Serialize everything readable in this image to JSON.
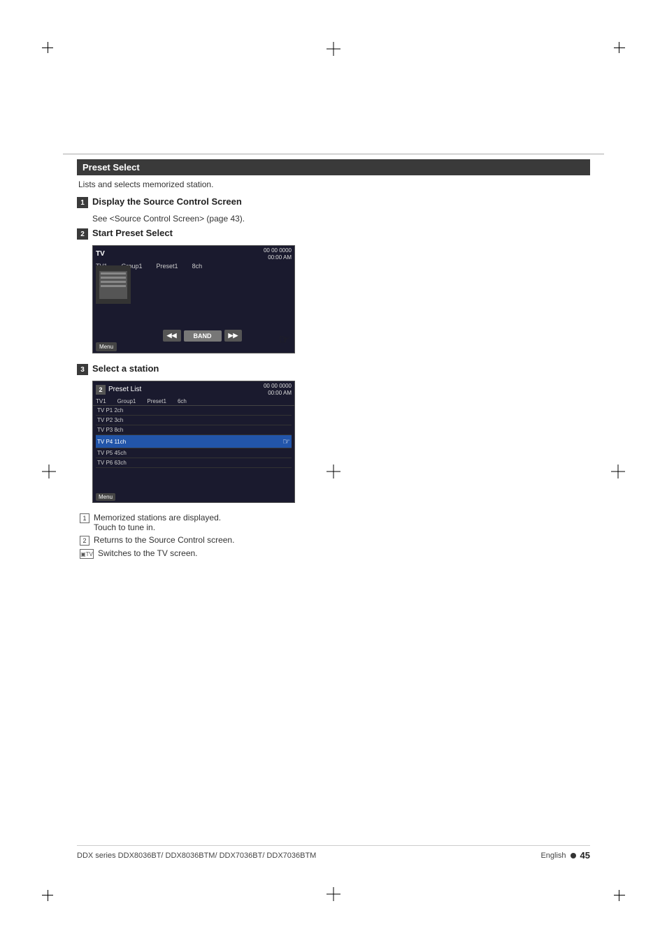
{
  "page": {
    "title": "Preset Select",
    "subtitle": "Lists and selects memorized station.",
    "footer_model": "DDX series  DDX8036BT/ DDX8036BTM/ DDX7036BT/ DDX7036BTM",
    "footer_lang": "English",
    "page_number": "45"
  },
  "steps": [
    {
      "num": "1",
      "title": "Display the Source Control Screen",
      "desc": "See <Source Control Screen> (page 43)."
    },
    {
      "num": "2",
      "title": "Start Preset Select",
      "desc": ""
    },
    {
      "num": "3",
      "title": "Select a station",
      "desc": ""
    }
  ],
  "tv_screen": {
    "label": "TV",
    "info_line1": "00 00 0000",
    "info_line2": "00:00 AM",
    "header_cols": [
      "TV1",
      "Group1",
      "Preset1",
      "8ch"
    ],
    "controls": [
      "◀◀",
      "BAND",
      "▶▶"
    ],
    "menu_label": "Menu"
  },
  "preset_screen": {
    "num_label": "2",
    "title": "Preset List",
    "info_line1": "00 00 0000",
    "info_line2": "00:00 AM",
    "header_cols": [
      "TV1",
      "Group1",
      "Preset1",
      "6ch"
    ],
    "rows": [
      {
        "text": "TV P1 2ch",
        "highlighted": false
      },
      {
        "text": "TV P2 3ch",
        "highlighted": false
      },
      {
        "text": "TV P3 8ch",
        "highlighted": false
      },
      {
        "text": "TV P4 11ch",
        "highlighted": true
      },
      {
        "text": "TV P5 45ch",
        "highlighted": false
      },
      {
        "text": "TV P6 63ch",
        "highlighted": false
      }
    ],
    "menu_label": "Menu"
  },
  "legend": [
    {
      "type": "num",
      "label": "1",
      "text": "Memorized stations are displayed.\nTouch to tune in."
    },
    {
      "type": "num",
      "label": "2",
      "text": "Returns to the Source Control screen."
    },
    {
      "type": "icon",
      "label": "TV",
      "text": "Switches to the TV screen."
    }
  ]
}
